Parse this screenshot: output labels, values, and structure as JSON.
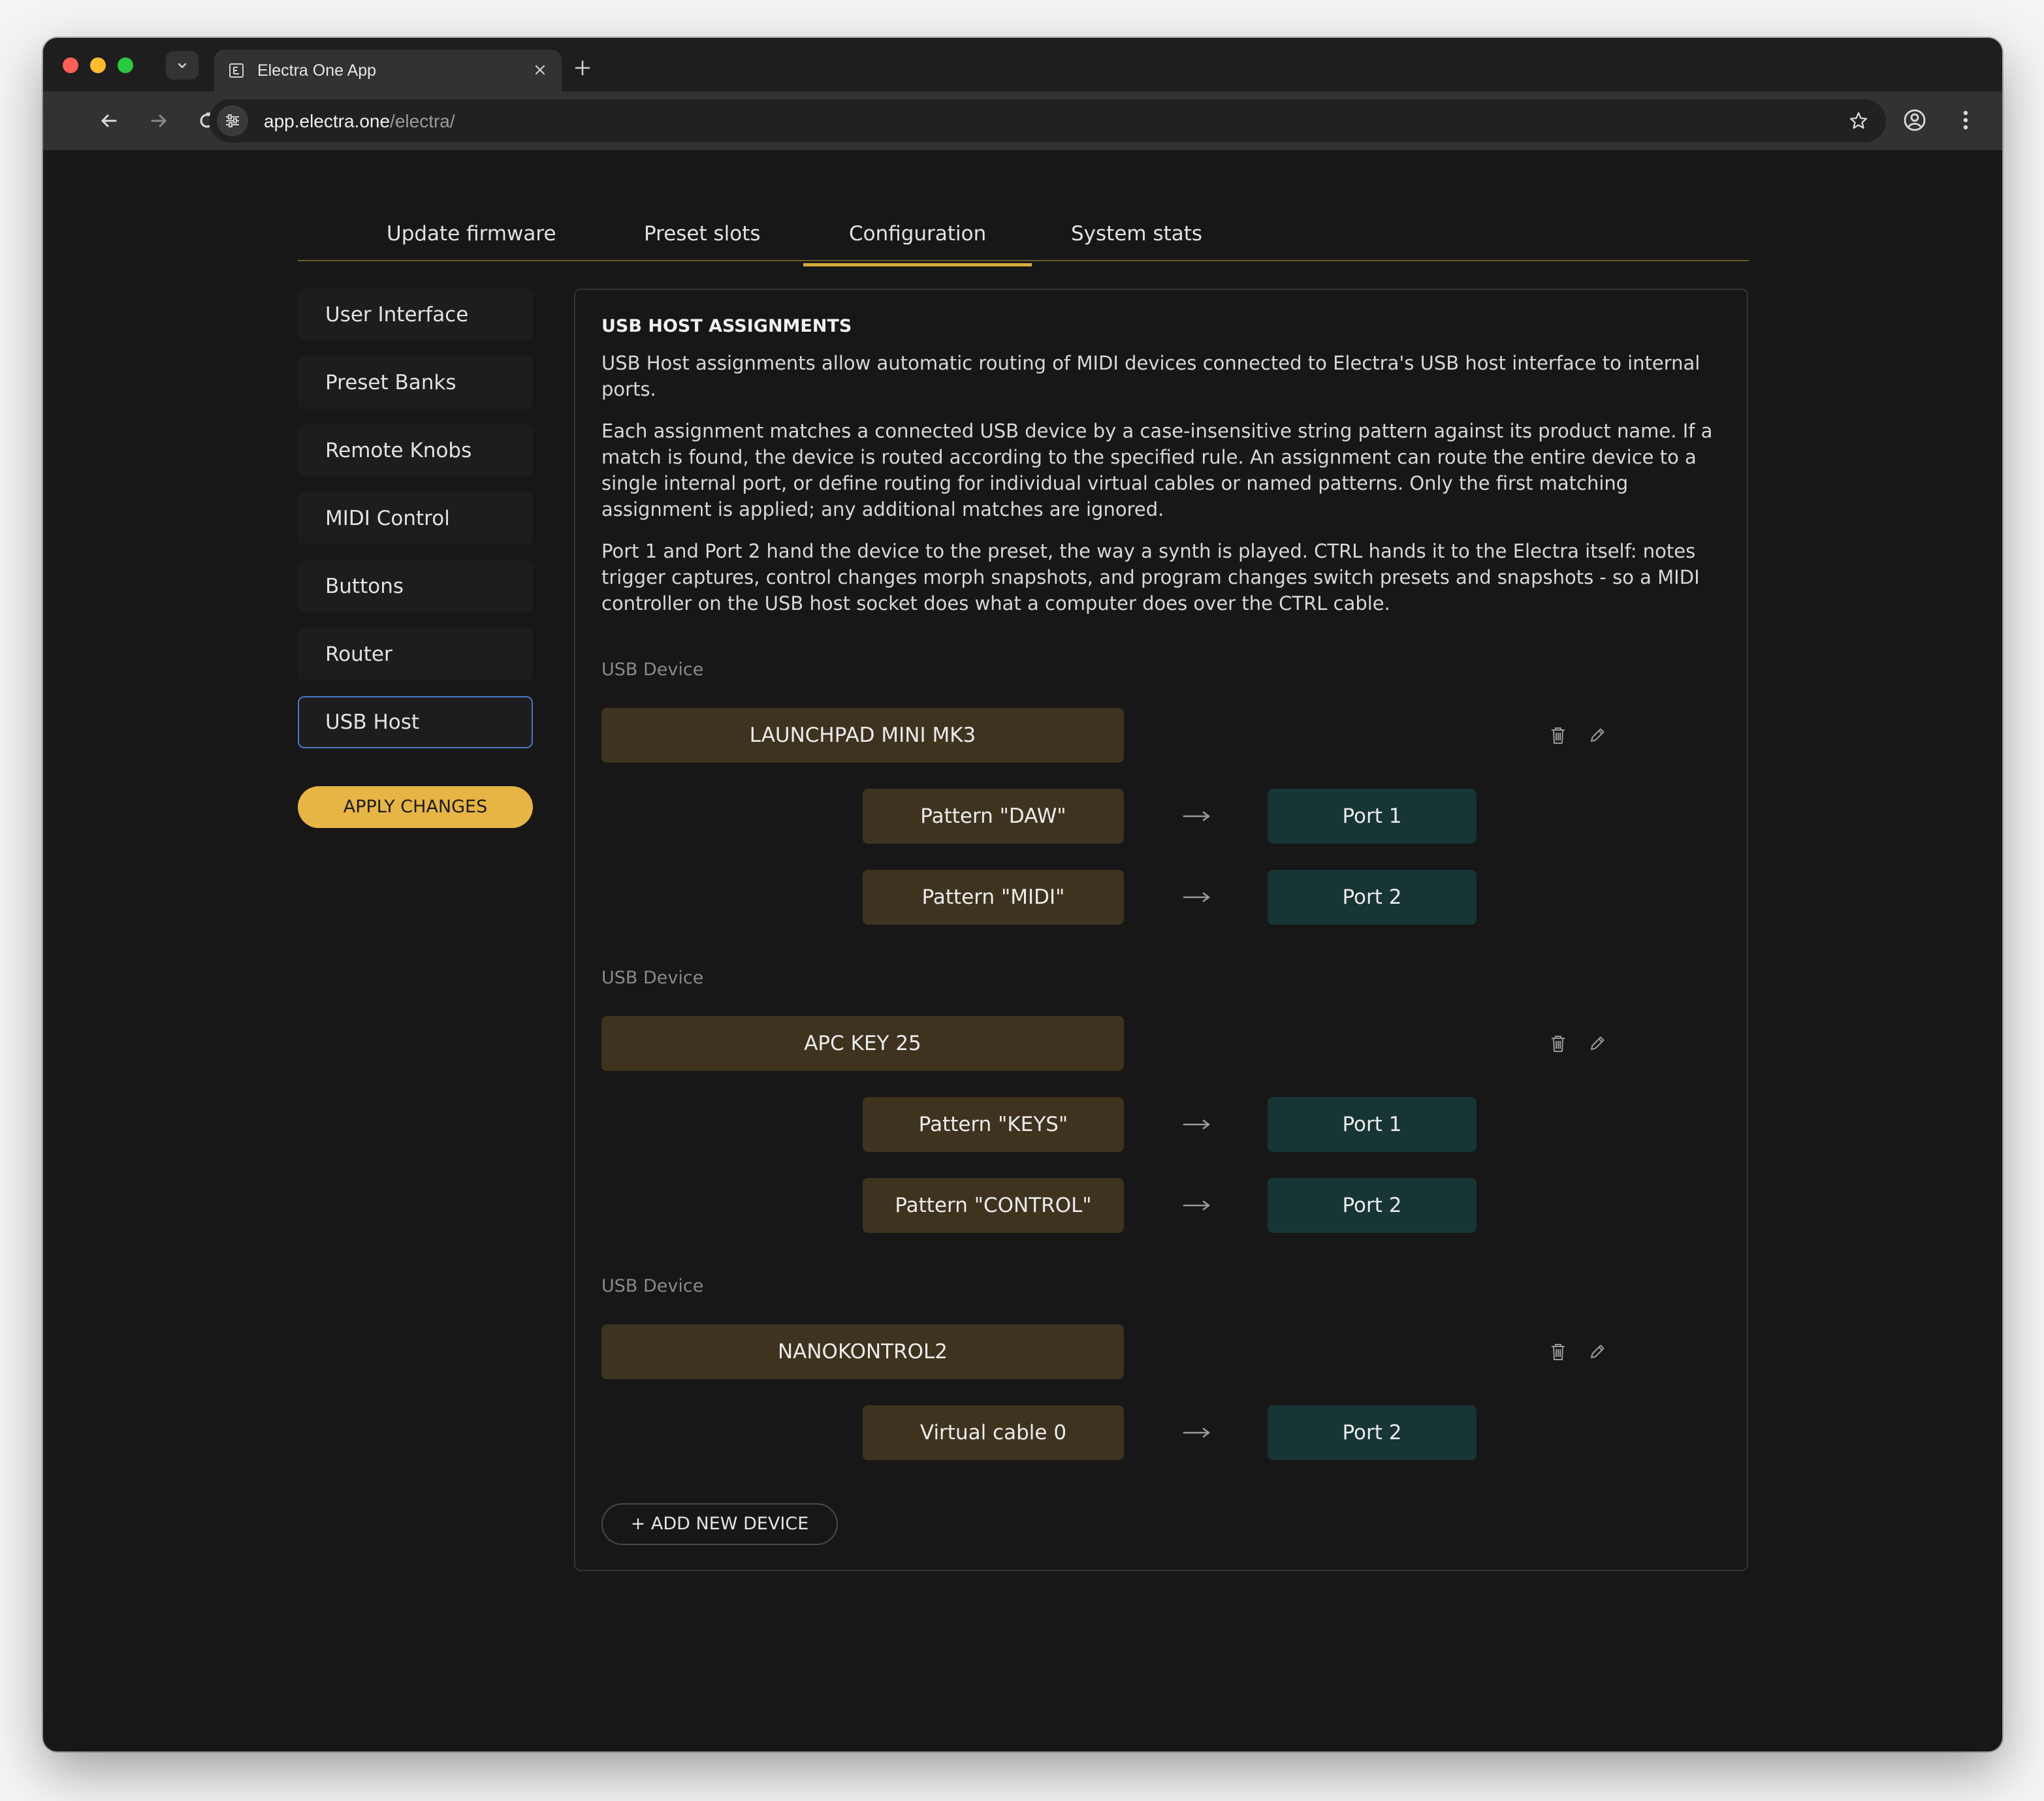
{
  "browser": {
    "tab_title": "Electra One App",
    "url_host": "app.electra.one",
    "url_path": "/electra/"
  },
  "top_nav": [
    "Update firmware",
    "Preset slots",
    "Configuration",
    "System stats"
  ],
  "active_top_nav": "Configuration",
  "sidebar": {
    "items": [
      "User Interface",
      "Preset Banks",
      "Remote Knobs",
      "MIDI Control",
      "Buttons",
      "Router",
      "USB Host"
    ],
    "active": "USB Host",
    "apply_label": "APPLY CHANGES"
  },
  "panel": {
    "title": "USB HOST ASSIGNMENTS",
    "paragraphs": [
      "USB Host assignments allow automatic routing of MIDI devices connected to Electra's USB host interface to internal ports.",
      "Each assignment matches a connected USB device by a case-insensitive string pattern against its product name. If a match is found, the device is routed according to the specified rule. An assignment can route the entire device to a single internal port, or define routing for individual virtual cables or named patterns. Only the first matching assignment is applied; any additional matches are ignored.",
      "Port 1 and Port 2 hand the device to the preset, the way a synth is played. CTRL hands it to the Electra itself: notes trigger captures, control changes morph snapshots, and program changes switch presets and snapshots - so a MIDI controller on the USB host socket does what a computer does over the CTRL cable."
    ],
    "device_label": "USB Device",
    "devices": [
      {
        "name": "LAUNCHPAD MINI MK3",
        "rules": [
          {
            "source": "Pattern \"DAW\"",
            "target": "Port 1"
          },
          {
            "source": "Pattern \"MIDI\"",
            "target": "Port 2"
          }
        ]
      },
      {
        "name": "APC KEY 25",
        "rules": [
          {
            "source": "Pattern \"KEYS\"",
            "target": "Port 1"
          },
          {
            "source": "Pattern \"CONTROL\"",
            "target": "Port 2"
          }
        ]
      },
      {
        "name": "NANOKONTROL2",
        "rules": [
          {
            "source": "Virtual cable 0",
            "target": "Port 2"
          }
        ]
      }
    ],
    "add_label": "+ ADD NEW DEVICE"
  },
  "colors": {
    "accent": "#e7b545",
    "device_pill": "#3e331f",
    "port_pill": "#173534",
    "active_border": "#4a78c8"
  }
}
